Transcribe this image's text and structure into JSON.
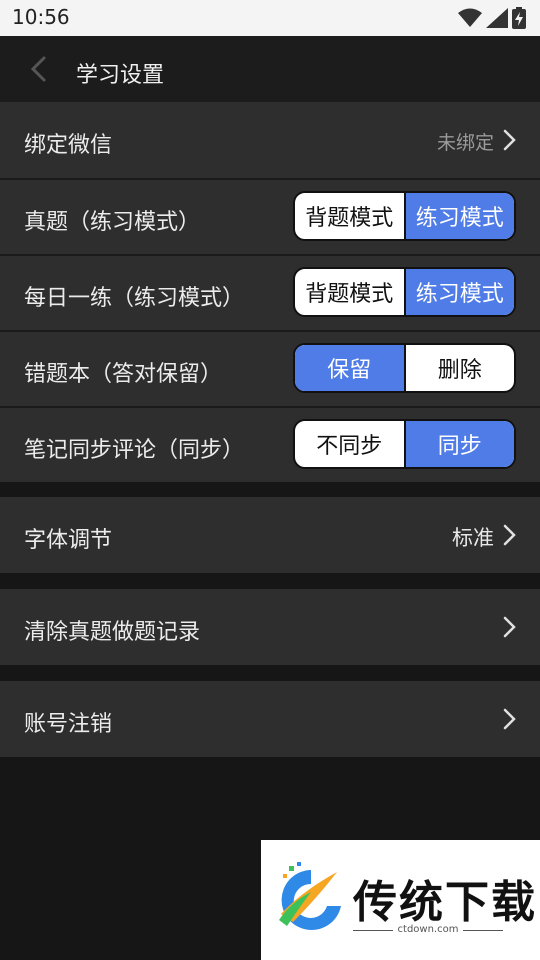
{
  "status_bar": {
    "time": "10:56"
  },
  "header": {
    "title": "学习设置"
  },
  "settings": {
    "wechat": {
      "label": "绑定微信",
      "value": "未绑定"
    },
    "zhenti": {
      "label": "真题（练习模式）",
      "options": [
        "背题模式",
        "练习模式"
      ],
      "selected": 1
    },
    "daily": {
      "label": "每日一练（练习模式）",
      "options": [
        "背题模式",
        "练习模式"
      ],
      "selected": 1
    },
    "wrongbook": {
      "label": "错题本（答对保留）",
      "options": [
        "保留",
        "删除"
      ],
      "selected": 0
    },
    "notes": {
      "label": "笔记同步评论（同步）",
      "options": [
        "不同步",
        "同步"
      ],
      "selected": 1
    },
    "font": {
      "label": "字体调节",
      "value": "标准"
    },
    "clear": {
      "label": "清除真题做题记录"
    },
    "cancel": {
      "label": "账号注销"
    }
  },
  "watermark": {
    "brand": "传统下载",
    "url": "ctdown.com"
  },
  "colors": {
    "accent": "#4f7ce6",
    "row_bg": "#2e2e2e",
    "page_bg": "#161616"
  }
}
